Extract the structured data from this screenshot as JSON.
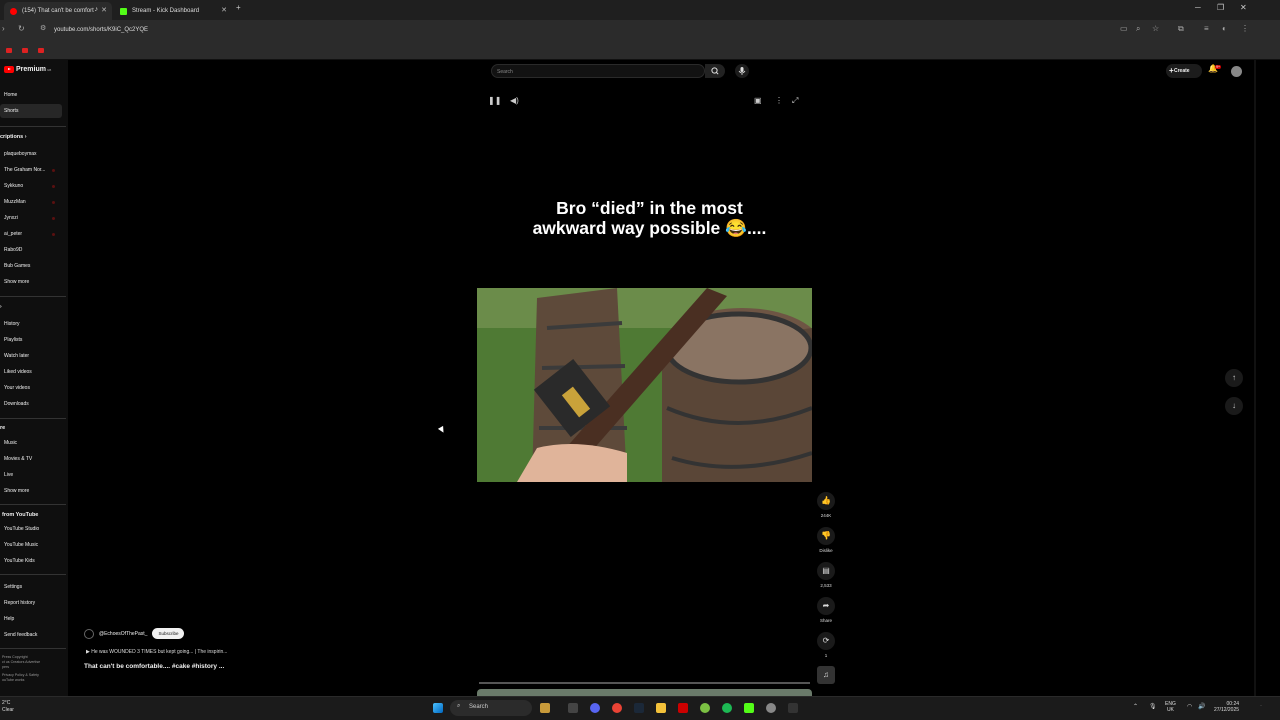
{
  "browser": {
    "tabs": [
      {
        "title": "(154) That can't be comfort",
        "active": true
      },
      {
        "title": "Stream - Kick Dashboard",
        "active": false
      }
    ],
    "url": "youtube.com/shorts/K9iC_Qc2YQE"
  },
  "youtube": {
    "logo_text": "Premium",
    "logo_sup": "GB",
    "search_placeholder": "Search",
    "create_label": "Create",
    "notification_badge": "9+"
  },
  "sidebar": {
    "main": [
      {
        "label": "Home",
        "selected": false
      },
      {
        "label": "Shorts",
        "selected": true
      }
    ],
    "subscriptions_header": "criptions",
    "subscriptions": [
      "plaqueboymax",
      "The Graham Nor...",
      "Sykkuno",
      "MuzzMan",
      "Jynxzi",
      "ai_peter",
      "Rabo9D",
      "Bub Games"
    ],
    "subs_show_more": "Show more",
    "you_items": [
      "History",
      "Playlists",
      "Watch later",
      "Liked videos",
      "Your videos",
      "Downloads"
    ],
    "explore_header": "re",
    "explore_items": [
      "Music",
      "Movies & TV",
      "Live"
    ],
    "explore_show_more": "Show more",
    "more_header": "from YouTube",
    "more_items": [
      "YouTube Studio",
      "YouTube Music",
      "YouTube Kids"
    ],
    "settings_items": [
      "Settings",
      "Report history",
      "Help",
      "Send feedback"
    ],
    "footer_lines": [
      "Press  Copyright",
      "ct us  Creators  Advertise",
      "pers",
      "Privacy  Policy & Safety",
      "ouTube works"
    ]
  },
  "short": {
    "caption_line1": "Bro “died” in the most",
    "caption_line2": "awkward way possible 😂....",
    "channel": "@EchoesOfThePast_",
    "subscribe_label": "Subscribe",
    "related_link": "He was WOUNDED 3 TIMES but kept going... | The inspirin...",
    "title": "That can't be comfortable.... #cake #history ..."
  },
  "actions": {
    "like_count": "244K",
    "dislike_label": "Dislike",
    "comment_count": "2,533",
    "share_label": "Share",
    "remix_count": "1"
  },
  "taskbar": {
    "weather_temp": "2°C",
    "weather_desc": "Clear",
    "search_label": "Search",
    "lang_top": "ENG",
    "lang_bottom": "UK",
    "time": "00:24",
    "date": "27/12/2025"
  },
  "colors": {
    "accent_red": "#ff0000",
    "background": "#000000",
    "sidebar_bg": "#0f0f0f"
  }
}
